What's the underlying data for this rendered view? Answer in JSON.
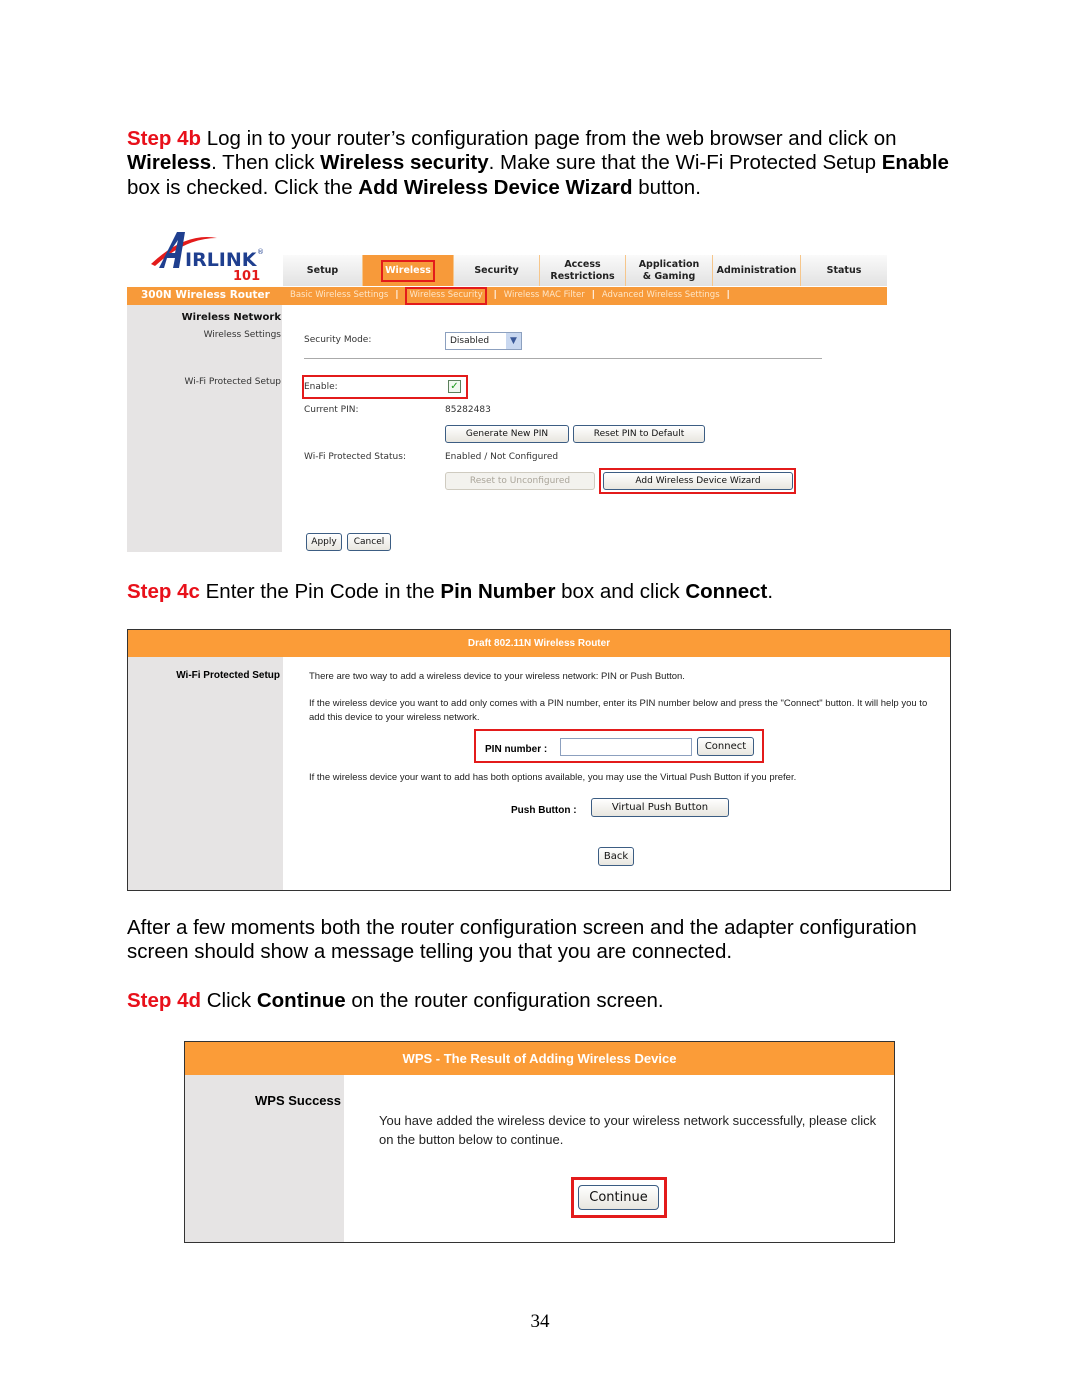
{
  "step4b": {
    "step_label": "Step 4b",
    "text1": " Log in to your router’s configuration page from the web browser and click on ",
    "bold1": "Wireless",
    "text2": ".  Then click ",
    "bold2": "Wireless security",
    "text3": ".  Make sure that the Wi-Fi Protected Setup ",
    "bold3": "Enable",
    "text4": " box is checked.  Click the ",
    "bold4": "Add Wireless Device Wizard",
    "text5": " button."
  },
  "router1": {
    "logo_text": "AIRLINK",
    "logo_num": "101",
    "tabs": [
      {
        "label": "Setup"
      },
      {
        "label": "Wireless"
      },
      {
        "label": "Security"
      },
      {
        "label": "Access Restrictions"
      },
      {
        "label": "Application & Gaming"
      },
      {
        "label": "Administration"
      },
      {
        "label": "Status"
      }
    ],
    "brand": "300N Wireless Router",
    "subnav": [
      {
        "label": "Basic Wireless Settings"
      },
      {
        "label": "Wireless Security"
      },
      {
        "label": "Wireless MAC Filter"
      },
      {
        "label": "Advanced Wireless Settings"
      }
    ],
    "side_heading": "Wireless Network",
    "side_item1": "Wireless Settings",
    "side_item2": "Wi-Fi Protected Setup",
    "security_mode_label": "Security Mode:",
    "security_mode_value": "Disabled",
    "enable_label": "Enable:",
    "enable_checked": true,
    "current_pin_label": "Current PIN:",
    "current_pin_value": "85282483",
    "generate_pin": "Generate New PIN",
    "reset_pin": "Reset PIN to Default",
    "status_label": "Wi-Fi Protected Status:",
    "status_value": "Enabled / Not Configured",
    "reset_unconfigured": "Reset to Unconfigured",
    "add_wizard": "Add Wireless Device Wizard",
    "apply": "Apply",
    "cancel": "Cancel"
  },
  "step4c": {
    "step_label": "Step 4c",
    "text1": " Enter the Pin Code in the ",
    "bold1": "Pin Number",
    "text2": " box and click ",
    "bold2": "Connect",
    "text3": "."
  },
  "router2": {
    "header": "Draft 802.11N Wireless Router",
    "side_heading": "Wi-Fi Protected Setup",
    "line1": "There are two way to add a wireless device to your wireless network: PIN or Push Button.",
    "line2": "If the wireless device you want to add only comes with a PIN number, enter its PIN number below and press the \"Connect\" button. It will help you to add this device to your wireless network.",
    "pin_label": "PIN number :",
    "pin_value": "",
    "connect": "Connect",
    "line3": "If the wireless device your want to add has both options available, you may use the Virtual Push Button if you prefer.",
    "push_label": "Push Button :",
    "virtual_push": "Virtual Push Button",
    "back": "Back"
  },
  "after_text": "After a few moments both the router configuration screen and the adapter configuration screen should show a message telling you that you are connected.",
  "step4d": {
    "step_label": "Step 4d",
    "text1": " Click ",
    "bold1": "Continue",
    "text2": " on the router configuration screen."
  },
  "router3": {
    "header": "WPS - The Result of Adding Wireless Device",
    "side_heading": "WPS Success",
    "message": "You have added the wireless device to your wireless network successfully, please click on the button below to continue.",
    "continue": "Continue"
  },
  "page_number": "34",
  "colors": {
    "step_red": "#e8101a",
    "orange": "#f79a3a",
    "highlight_red": "#e31b1b",
    "side_gray": "#e6e4e4"
  }
}
